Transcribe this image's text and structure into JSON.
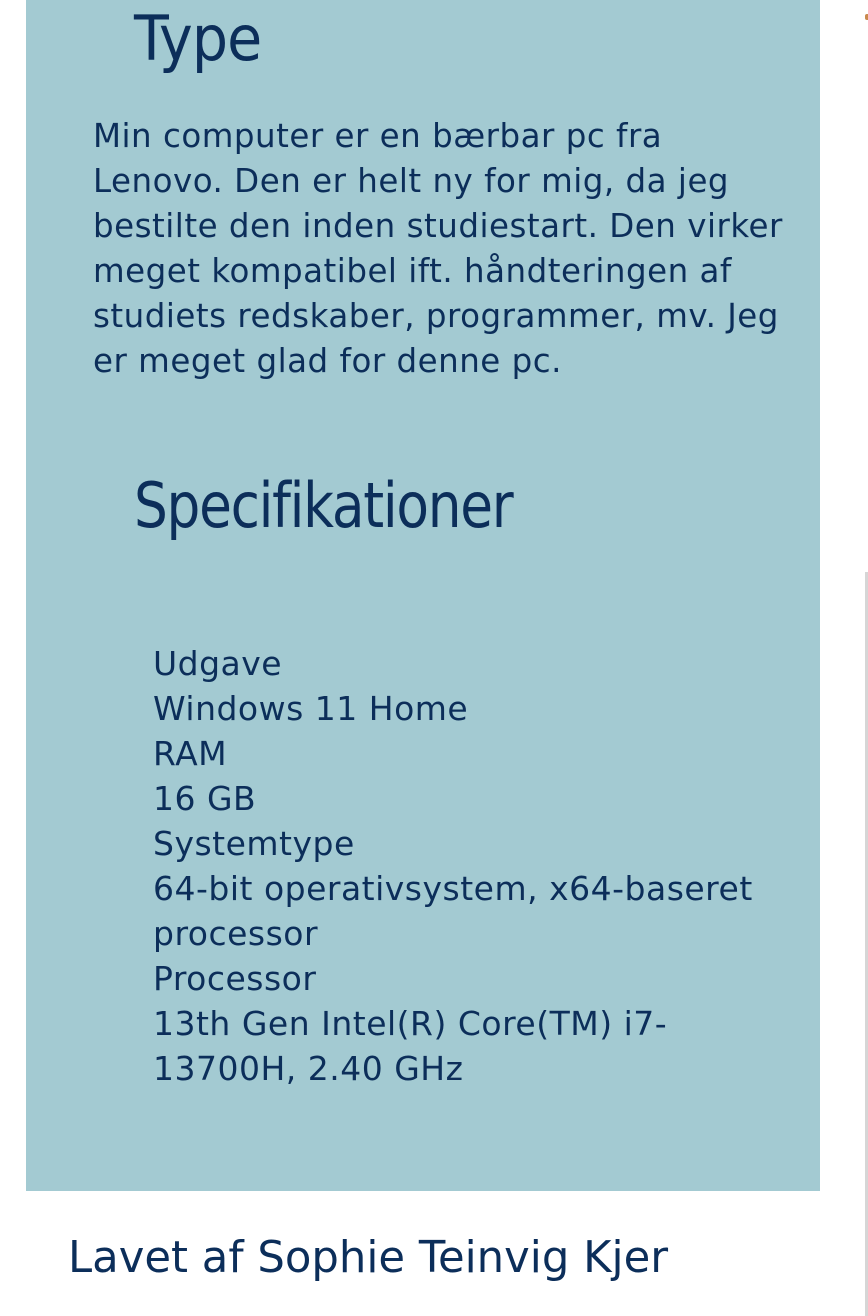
{
  "sections": {
    "type": {
      "heading": "Type",
      "body": "Min computer er en bærbar pc fra Lenovo. Den er helt ny for mig, da jeg bestilte den inden studiestart. Den virker meget kompatibel ift. håndteringen af studiets redskaber, programmer, mv. Jeg er meget glad for denne pc."
    },
    "specifications": {
      "heading": "Specifikationer",
      "items": [
        {
          "label": "Udgave",
          "value": "Windows 11 Home"
        },
        {
          "label": "RAM",
          "value": "16 GB"
        },
        {
          "label": "Systemtype",
          "value": "64-bit operativsystem, x64-baseret processor"
        },
        {
          "label": "Processor",
          "value": "13th Gen Intel(R) Core(TM) i7-13700H, 2.40 GHz"
        }
      ]
    }
  },
  "footer": {
    "credit": "Lavet af Sophie Teinvig Kjer"
  },
  "colors": {
    "card_background": "#a3cad2",
    "text": "#0c2e5a",
    "page_background": "#ffffff"
  }
}
